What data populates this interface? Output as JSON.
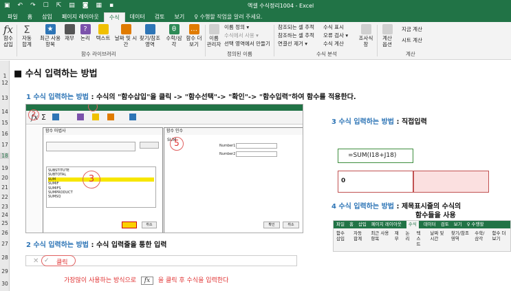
{
  "window": {
    "title": "엑셀 수식정리1004 - Excel",
    "qat": [
      "▣",
      "↶",
      "↷",
      "☐",
      "⇱",
      "▤",
      "◙",
      "▦",
      "▪"
    ]
  },
  "tabs": [
    "파일",
    "홈",
    "삽입",
    "페이지 레이아웃",
    "수식",
    "데이터",
    "검토",
    "보기",
    "♀ 수행할 작업을 알려 주세요."
  ],
  "ribbon": {
    "insert_function": "함수 삽입",
    "autosum": "자동 합계",
    "recent": "최근 사용 항목",
    "financial": "재무",
    "logical": "논리",
    "text": "텍스트",
    "datetime": "날짜 및 시간",
    "lookup": "찾기/참조 영역",
    "math": "수학/삼각",
    "more": "함수 더 보기",
    "name_manager": "이름 관리자",
    "define_name": "이름 정의 ▾",
    "use_in_formula": "수식에서 사용 ▾",
    "create_from_selection": "선택 영역에서 만들기",
    "trace_precedents": "참조되는 셀 추적",
    "trace_dependents": "참조하는 셀 추적",
    "remove_arrows": "연결선 제거 ▾",
    "show_formulas": "수식 표시",
    "error_checking": "오류 검사 ▾",
    "evaluate": "수식 계산",
    "watch": "조사식 창",
    "calc_options": "계산 옵션",
    "calc_now": "지금 계산",
    "calc_sheet": "시트 계산",
    "group_library": "함수 라이브러리",
    "group_names": "정의된 이름",
    "group_audit": "수식 분석",
    "group_calc": "계산"
  },
  "rows": [
    "1",
    "12",
    "13",
    "14",
    "15",
    "16",
    "17",
    "18",
    "19",
    "20",
    "21",
    "22",
    "23",
    "24",
    "25",
    "26",
    "27",
    "28",
    "29",
    "30"
  ],
  "content": {
    "heading": "■ 수식 입력하는 방법",
    "m1_prefix": "1 수식 입력하는 방법",
    "m1_text": " : 수식의 \"함수삽입\"을 클릭 -> \"함수선택\"-> \"확인\"-> \"함수입력\"하여 함수를 적용한다.",
    "m2_prefix": "2 수식 입력하는 방법",
    "m2_text": " : 수식 입력줄을 통한 입력",
    "s3_prefix": "3 수식 입력하는 방법",
    "s3_text": " : 직접입력",
    "formula": "=SUM(I18+J18)",
    "result": "0",
    "s4_prefix": "4 수식 입력하는 방법",
    "s4_text": " : 제목표시줄의 수식의",
    "s4_line2": "함수들을 사용",
    "fbar_x": "✕",
    "fbar_check": "✓",
    "fbar_value": "클릭",
    "note_before": "가장많이 사용하는 방식으로",
    "note_fx": "fx",
    "note_after": "을 클릭 후 수식을 입력한다"
  },
  "screenshot1": {
    "circle2": "2",
    "circle3": "3",
    "circle5": "5",
    "dialog1_title": "함수 마법사",
    "dialog2_title": "함수 인수",
    "arg_label": "SUM",
    "number1": "Number1",
    "number2": "Number2",
    "ok": "확인",
    "cancel": "취소",
    "functions": [
      "SUBSTITUTE",
      "SUBTOTAL",
      "SUM",
      "SUMIF",
      "SUMIFS",
      "SUMPRODUCT",
      "SUMSQ"
    ]
  },
  "mini": {
    "tabs": [
      "파일",
      "홈",
      "삽입",
      "페이지 레이아웃",
      "수식",
      "데이터",
      "검토",
      "보기",
      "♀ 수행할"
    ],
    "items": [
      "함수 삽입",
      "자동 합계",
      "최근 사용 항목",
      "재무",
      "논리",
      "텍스트",
      "날짜 및 시간",
      "찾기/참조 영역",
      "수학/삼각",
      "함수 더 보기"
    ]
  },
  "colors": {
    "excel_green": "#217346",
    "accent_blue": "#2e75b6",
    "red": "#c00000"
  }
}
